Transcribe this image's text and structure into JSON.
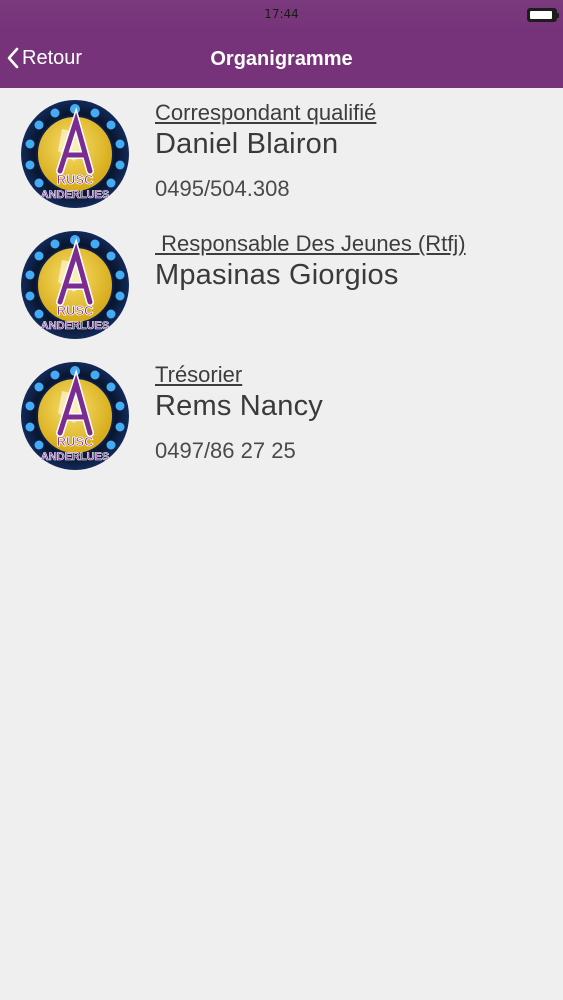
{
  "status_bar": {
    "time": "17:44",
    "battery_level": 0.9
  },
  "nav": {
    "back_label": "Retour",
    "title": "Organigramme"
  },
  "contacts": [
    {
      "role": "Correspondant qualifié",
      "name": "Daniel Blairon",
      "phone": "0495/504.308",
      "avatar_text": "RUSC ANDERLUES"
    },
    {
      "role": " Responsable Des Jeunes (Rtfj)",
      "name": "Mpasinas Giorgios",
      "phone": "",
      "avatar_text": "RUSC ANDERLUES"
    },
    {
      "role": "Trésorier",
      "name": "Rems Nancy",
      "phone": "0497/86 27 25",
      "avatar_text": "RUSC ANDERLUES"
    }
  ],
  "colors": {
    "nav_background": "#76337a",
    "page_background": "#efeff0",
    "text": "#3a3a3a",
    "badge_ring": "#1c3f80",
    "badge_glow": "#39a6f5",
    "badge_ball": "#f2cd3b",
    "badge_letter": "#7b2c90"
  }
}
